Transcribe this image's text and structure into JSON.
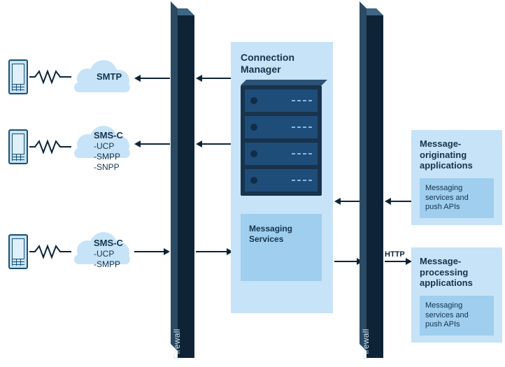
{
  "phones": [
    "phone",
    "phone",
    "phone"
  ],
  "clouds": [
    {
      "id": "c1",
      "title": "SMTP",
      "lines": []
    },
    {
      "id": "c2",
      "title": "SMS-C",
      "lines": [
        "-UCP",
        "-SMPP",
        "-SNPP"
      ]
    },
    {
      "id": "c3",
      "title": "SMS-C",
      "lines": [
        "-UCP",
        "-SMPP"
      ]
    }
  ],
  "firewall_label": "Firewall",
  "connection_manager": {
    "title1": "Connection",
    "title2": "Manager",
    "messaging1": "Messaging",
    "messaging2": "Services"
  },
  "http_label": "HTTP",
  "apps": {
    "orig": {
      "title1": "Message-",
      "title2": "originating",
      "title3": "applications",
      "sub1": "Messaging",
      "sub2": "services and",
      "sub3": "push APIs"
    },
    "proc": {
      "title1": "Message-",
      "title2": "processing",
      "title3": "applications",
      "sub1": "Messaging",
      "sub2": "services and",
      "sub3": "push APIs"
    }
  }
}
